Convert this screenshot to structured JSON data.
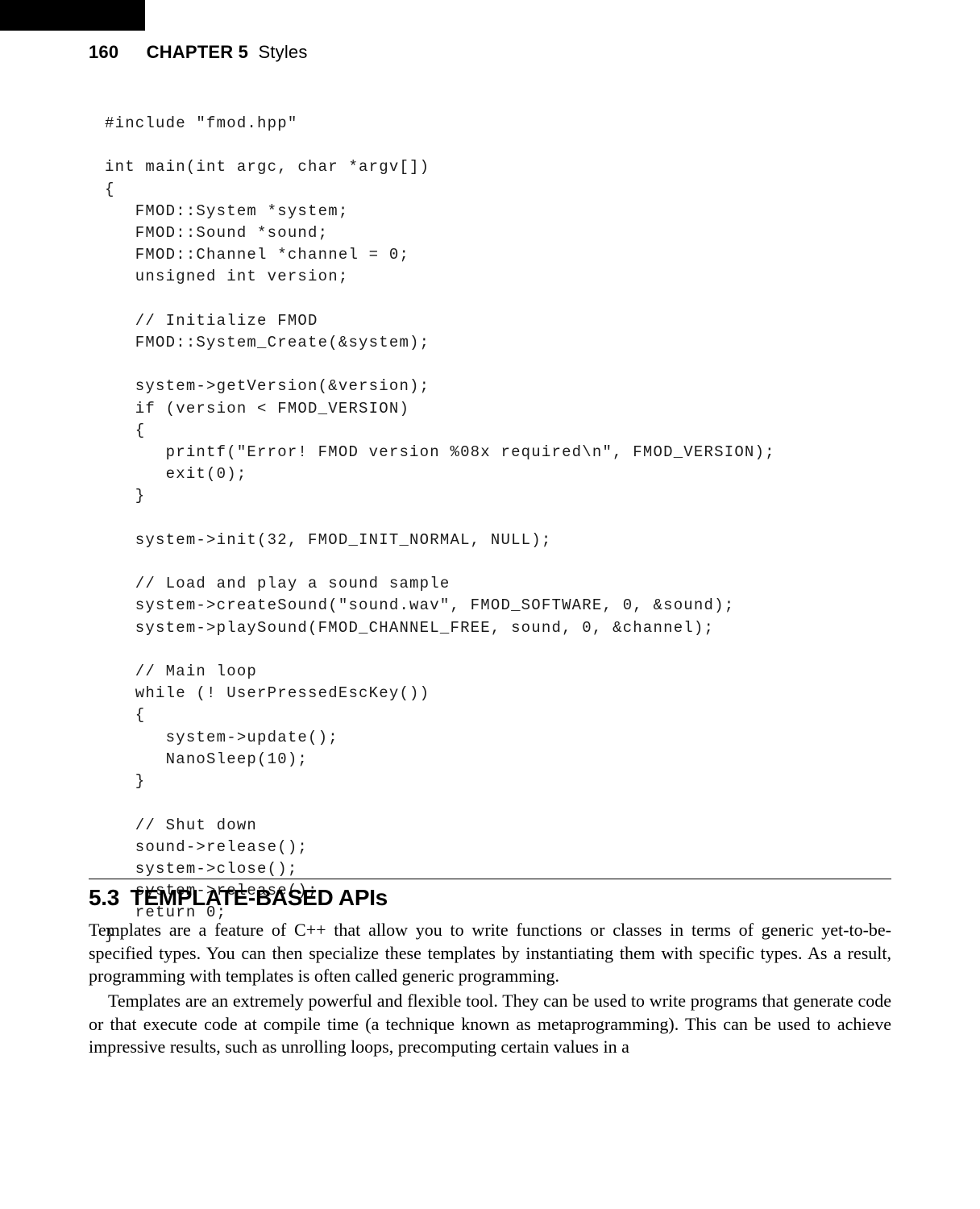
{
  "header": {
    "page_number": "160",
    "chapter_label": "CHAPTER 5",
    "chapter_title": "Styles"
  },
  "code": "#include \"fmod.hpp\"\n\nint main(int argc, char *argv[])\n{\n   FMOD::System *system;\n   FMOD::Sound *sound;\n   FMOD::Channel *channel = 0;\n   unsigned int version;\n\n   // Initialize FMOD\n   FMOD::System_Create(&system);\n\n   system->getVersion(&version);\n   if (version < FMOD_VERSION)\n   {\n      printf(\"Error! FMOD version %08x required\\n\", FMOD_VERSION);\n      exit(0);\n   }\n\n   system->init(32, FMOD_INIT_NORMAL, NULL);\n\n   // Load and play a sound sample\n   system->createSound(\"sound.wav\", FMOD_SOFTWARE, 0, &sound);\n   system->playSound(FMOD_CHANNEL_FREE, sound, 0, &channel);\n\n   // Main loop\n   while (! UserPressedEscKey())\n   {\n      system->update();\n      NanoSleep(10);\n   }\n\n   // Shut down\n   sound->release();\n   system->close();\n   system->release();\n   return 0;\n}",
  "section": {
    "number": "5.3",
    "title": "TEMPLATE-BASED APIs"
  },
  "paragraphs": {
    "p1": "Templates are a feature of C++ that allow you to write functions or classes in terms of generic yet-to-be-specified types. You can then specialize these templates by instantiating them with specific types. As a result, programming with templates is often called generic programming.",
    "p2": "Templates are an extremely powerful and flexible tool. They can be used to write programs that generate code or that execute code at compile time (a technique known as metaprogramming). This can be used to achieve impressive results, such as unrolling loops, precomputing certain values in a"
  }
}
